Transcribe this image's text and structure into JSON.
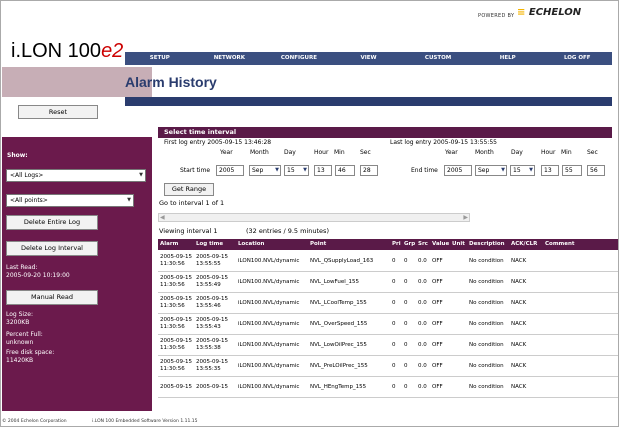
{
  "brand": {
    "powered": "POWERED BY",
    "name": "ECHELON"
  },
  "logo": {
    "main": "i.LON 100",
    "suffix": "e2"
  },
  "nav": [
    "SETUP",
    "NETWORK",
    "CONFIGURE",
    "VIEW",
    "CUSTOM",
    "HELP",
    "LOG OFF"
  ],
  "page_title": "Alarm History",
  "sidebar": {
    "reset": "Reset",
    "show_label": "Show:",
    "logs_select": "<All Logs>",
    "points_select": "<All points>",
    "delete_entire": "Delete Entire Log",
    "delete_interval": "Delete Log Interval",
    "last_read_label": "Last Read:",
    "last_read_value": "2005-09-20 10:19:00",
    "manual_read": "Manual Read",
    "log_size_label": "Log Size:",
    "log_size_value": "3200KB",
    "percent_full_label": "Percent Full:",
    "percent_full_value": "unknown",
    "free_disk_label": "Free disk space:",
    "free_disk_value": "11420KB"
  },
  "interval": {
    "heading": "Select time interval",
    "first_entry": "First log entry 2005-09-15 13:46:28",
    "last_entry": "Last log entry 2005-09-15 13:55:55",
    "col_year": "Year",
    "col_month": "Month",
    "col_day": "Day",
    "col_hour": "Hour",
    "col_min": "Min",
    "col_sec": "Sec",
    "start_label": "Start time",
    "start": {
      "year": "2005",
      "month": "Sep",
      "day": "15",
      "hour": "13",
      "min": "46",
      "sec": "28"
    },
    "end_label": "End time",
    "end": {
      "year": "2005",
      "month": "Sep",
      "day": "15",
      "hour": "13",
      "min": "55",
      "sec": "56"
    },
    "get_range": "Get Range",
    "goto": "Go to interval 1 of 1",
    "viewing": "Viewing interval 1",
    "entries": "(32 entries / 9.5 minutes)"
  },
  "table": {
    "headers": [
      "Alarm time",
      "Log time",
      "Location",
      "Point",
      "Pri",
      "Grp",
      "Src",
      "Value",
      "Unit",
      "Description",
      "ACK/CLR",
      "Comment"
    ],
    "rows": [
      {
        "alarm1": "2005-09-15",
        "alarm2": "11:30:56",
        "log1": "2005-09-15",
        "log2": "13:55:55",
        "location": "iLON100.NVL/dynamic",
        "point": "NVL_QSupplyLoad_163",
        "pri": "0",
        "grp": "0",
        "src": "0.0",
        "value": "OFF",
        "desc": "No condition",
        "ack": "NACK"
      },
      {
        "alarm1": "2005-09-15",
        "alarm2": "11:30:56",
        "log1": "2005-09-15",
        "log2": "13:55:49",
        "location": "iLON100.NVL/dynamic",
        "point": "NVL_LowFuel_155",
        "pri": "0",
        "grp": "0",
        "src": "0.0",
        "value": "OFF",
        "desc": "No condition",
        "ack": "NACK"
      },
      {
        "alarm1": "2005-09-15",
        "alarm2": "11:30:56",
        "log1": "2005-09-15",
        "log2": "13:55:46",
        "location": "iLON100.NVL/dynamic",
        "point": "NVL_LCoolTemp_155",
        "pri": "0",
        "grp": "0",
        "src": "0.0",
        "value": "OFF",
        "desc": "No condition",
        "ack": "NACK"
      },
      {
        "alarm1": "2005-09-15",
        "alarm2": "11:30:56",
        "log1": "2005-09-15",
        "log2": "13:55:43",
        "location": "iLON100.NVL/dynamic",
        "point": "NVL_OverSpeed_155",
        "pri": "0",
        "grp": "0",
        "src": "0.0",
        "value": "OFF",
        "desc": "No condition",
        "ack": "NACK"
      },
      {
        "alarm1": "2005-09-15",
        "alarm2": "11:30:56",
        "log1": "2005-09-15",
        "log2": "13:55:38",
        "location": "iLON100.NVL/dynamic",
        "point": "NVL_LowOilPrec_155",
        "pri": "0",
        "grp": "0",
        "src": "0.0",
        "value": "OFF",
        "desc": "No condition",
        "ack": "NACK"
      },
      {
        "alarm1": "2005-09-15",
        "alarm2": "11:30:56",
        "log1": "2005-09-15",
        "log2": "13:55:35",
        "location": "iLON100.NVL/dynamic",
        "point": "NVL_PreLOilPrec_155",
        "pri": "0",
        "grp": "0",
        "src": "0.0",
        "value": "OFF",
        "desc": "No condition",
        "ack": "NACK"
      },
      {
        "alarm1": "2005-09-15",
        "alarm2": "",
        "log1": "2005-09-15",
        "log2": "",
        "location": "iLON100.NVL/dynamic",
        "point": "NVL_HEngTemp_155",
        "pri": "0",
        "grp": "0",
        "src": "0.0",
        "value": "OFF",
        "desc": "No condition",
        "ack": "NACK"
      }
    ]
  },
  "footer": {
    "copyright": "© 2004 Echelon Corporation",
    "version": "i.LON 100 Embedded Software Version 1.11.15"
  }
}
